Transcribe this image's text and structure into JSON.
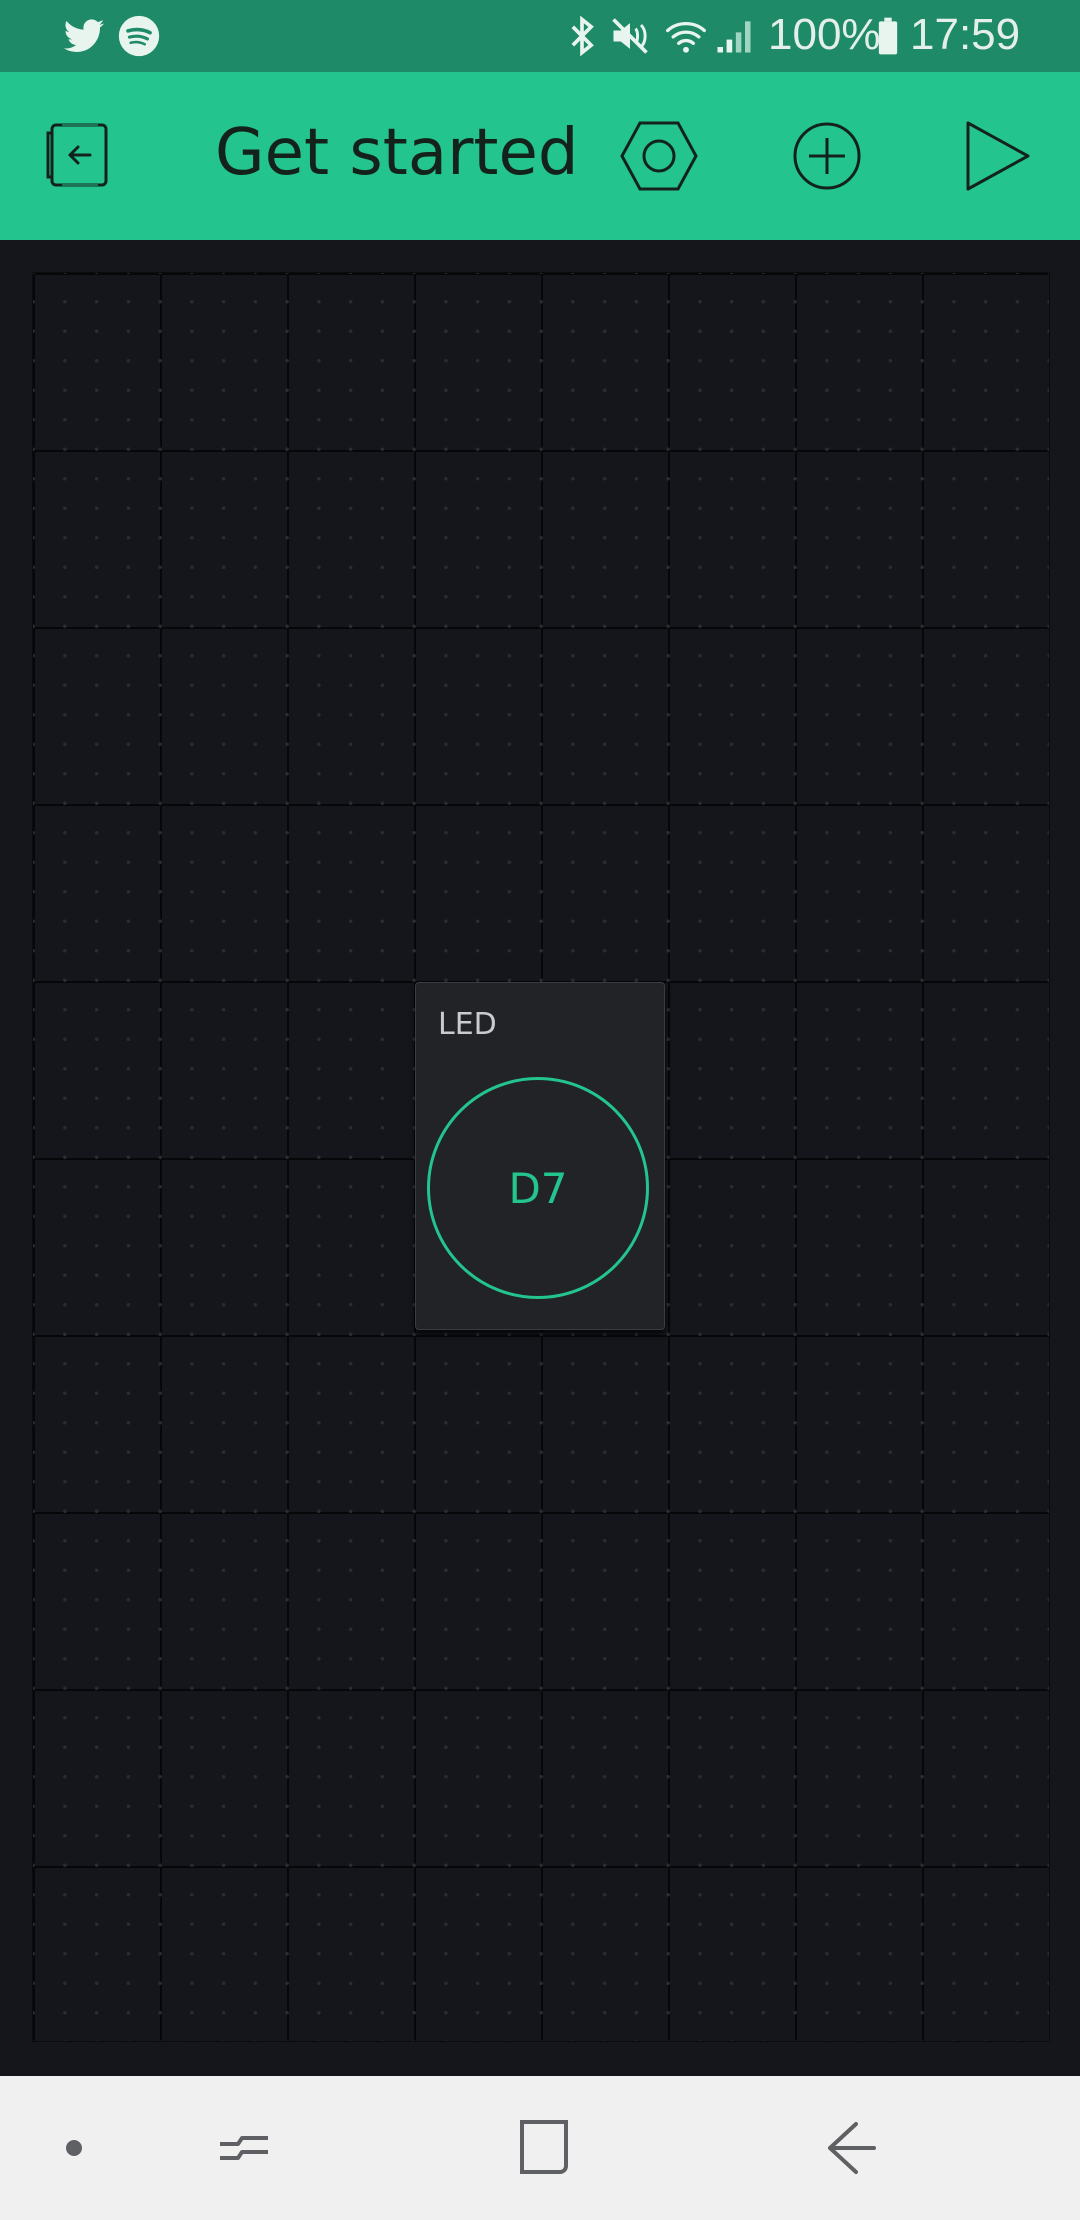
{
  "status_bar": {
    "battery": "100%",
    "time": "17:59",
    "icons": [
      "twitter-icon",
      "spotify-icon",
      "bluetooth-icon",
      "mute-icon",
      "wifi-icon",
      "signal-icon",
      "battery-icon"
    ]
  },
  "app_bar": {
    "title": "Get started",
    "background_color": "#23c48e",
    "buttons": [
      "exit-icon",
      "settings-hexagon-icon",
      "add-widget-icon",
      "play-icon"
    ]
  },
  "canvas": {
    "widgets": [
      {
        "type": "LED",
        "label": "LED",
        "pin": "D7",
        "accent_color": "#23c48e"
      }
    ]
  },
  "nav_bar": {
    "buttons": [
      "dot-icon",
      "recent-apps-icon",
      "home-icon",
      "back-icon"
    ]
  }
}
